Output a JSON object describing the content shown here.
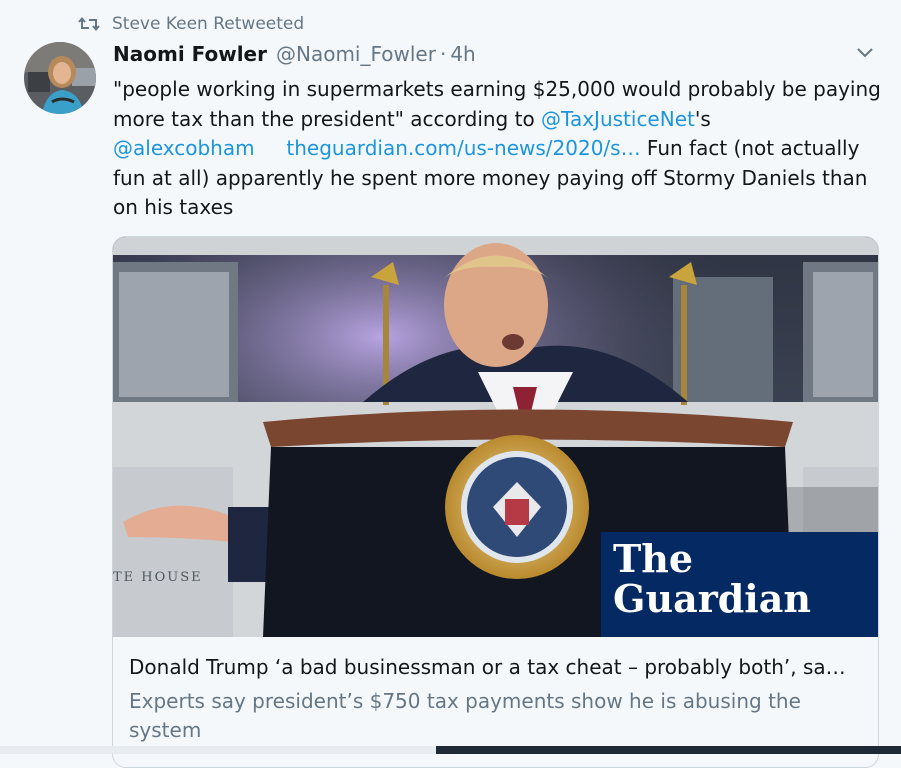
{
  "retweet": {
    "label": "Steve Keen Retweeted"
  },
  "author": {
    "name": "Naomi Fowler",
    "handle": "@Naomi_Fowler",
    "separator": "·",
    "time": "4h"
  },
  "tweet": {
    "text_part1": "\"people working in supermarkets earning $25,000 would probably be paying more tax than the president\" according to ",
    "mention1": "@TaxJusticeNet",
    "text_part2": "'s",
    "mention2": "@alexcobham",
    "link": "theguardian.com/us-news/2020/s…",
    "text_part3": " Fun fact (not actually fun at all) apparently he spent more money paying off Stormy Daniels than on his taxes"
  },
  "card": {
    "image_alt_logo_line1": "The",
    "image_alt_logo_line2": "Guardian",
    "house_text": "TE HOUSE",
    "title": "Donald Trump ‘a bad businessman or a tax cheat – probably both’, sa…",
    "description": "Experts say president’s $750 tax payments show he is abusing the system"
  },
  "colors": {
    "link": "#1b95e0",
    "muted": "#657786",
    "guardian_bg": "#052962"
  },
  "icons": {
    "retweet": "retweet-icon",
    "caret": "chevron-down-icon"
  }
}
